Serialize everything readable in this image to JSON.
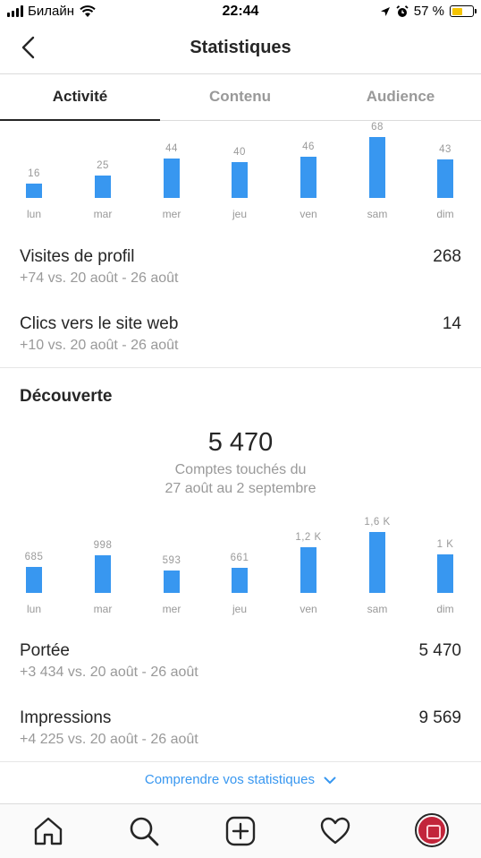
{
  "status_bar": {
    "carrier": "Билайн",
    "time": "22:44",
    "battery": "57 %",
    "battery_level": 0.57
  },
  "header": {
    "title": "Statistiques",
    "back_icon": "chevron-left-icon"
  },
  "tabs": [
    {
      "label": "Activité",
      "active": true
    },
    {
      "label": "Contenu",
      "active": false
    },
    {
      "label": "Audience",
      "active": false
    }
  ],
  "interactions_chart": {
    "chart_data": {
      "type": "bar",
      "categories": [
        "lun",
        "mar",
        "mer",
        "jeu",
        "ven",
        "sam",
        "dim"
      ],
      "values": [
        16,
        25,
        44,
        40,
        46,
        68,
        43
      ],
      "value_labels": [
        "16",
        "25",
        "44",
        "40",
        "46",
        "68",
        "43"
      ],
      "color": "#3897f0"
    }
  },
  "metrics_activity": [
    {
      "title": "Visites de profil",
      "subtitle": "+74 vs. 20 août - 26 août",
      "value": "268"
    },
    {
      "title": "Clics vers le site web",
      "subtitle": "+10 vs. 20 août - 26 août",
      "value": "14"
    }
  ],
  "discovery": {
    "title": "Découverte",
    "big_number": "5 470",
    "caption_line1": "Comptes touchés du",
    "caption_line2": "27 août au 2 septembre"
  },
  "reach_chart": {
    "chart_data": {
      "type": "bar",
      "categories": [
        "lun",
        "mar",
        "mer",
        "jeu",
        "ven",
        "sam",
        "dim"
      ],
      "values": [
        685,
        998,
        593,
        661,
        1200,
        1600,
        1000
      ],
      "value_labels": [
        "685",
        "998",
        "593",
        "661",
        "1,2 K",
        "1,6 K",
        "1 K"
      ],
      "color": "#3897f0"
    }
  },
  "metrics_discovery": [
    {
      "title": "Portée",
      "subtitle": "+3 434 vs. 20 août - 26 août",
      "value": "5 470"
    },
    {
      "title": "Impressions",
      "subtitle": "+4 225 vs. 20 août - 26 août",
      "value": "9 569"
    }
  ],
  "footer_link": {
    "label": "Comprendre vos statistiques",
    "icon": "chevron-down-icon"
  },
  "bottom_nav": [
    {
      "icon": "home-icon"
    },
    {
      "icon": "search-icon"
    },
    {
      "icon": "add-post-icon"
    },
    {
      "icon": "heart-icon"
    },
    {
      "icon": "profile-avatar"
    }
  ]
}
